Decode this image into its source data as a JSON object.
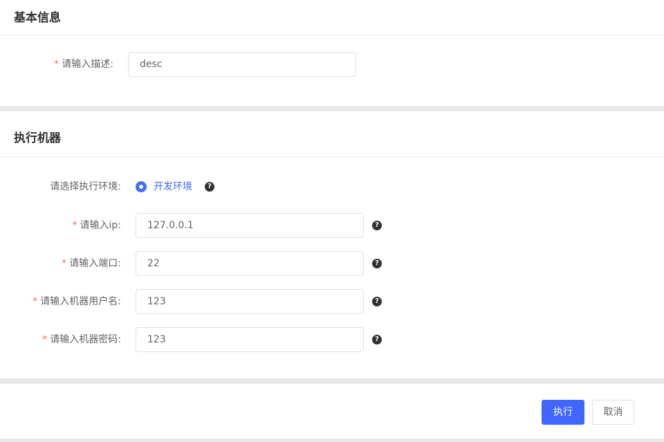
{
  "basic_info": {
    "title": "基本信息",
    "desc": {
      "required_mark": "*",
      "label": "请输入描述:",
      "value": "desc"
    }
  },
  "machine": {
    "title": "执行机器",
    "env": {
      "label": "请选择执行环境:",
      "option": "开发环境",
      "help_icon": "question-circle-icon"
    },
    "ip": {
      "required_mark": "*",
      "label": "请输入ip:",
      "value": "127.0.0.1"
    },
    "port": {
      "required_mark": "*",
      "label": "请输入端口:",
      "value": "22"
    },
    "username": {
      "required_mark": "*",
      "label": "请输入机器用户名:",
      "value": "123"
    },
    "password": {
      "required_mark": "*",
      "label": "请输入机器密码:",
      "value": "123"
    }
  },
  "footer": {
    "execute_label": "执行",
    "cancel_label": "取消"
  },
  "colors": {
    "primary": "#4066fd",
    "required": "#f56c6c",
    "background": "#e8e8e8"
  }
}
